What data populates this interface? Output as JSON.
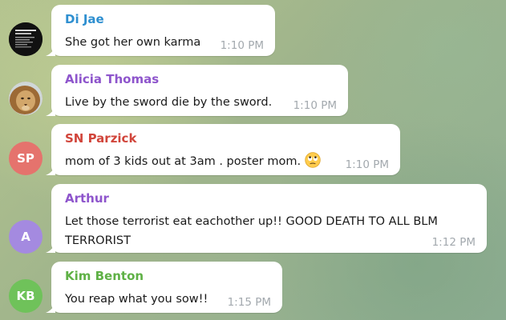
{
  "colors": {
    "bubble": "#ffffff",
    "time": "#a3a9ae",
    "text": "#1a1a1a"
  },
  "messages": [
    {
      "sender": "Di Jae",
      "sender_color": "#2e8fd0",
      "text": "She got her own karma",
      "time": "1:10 PM",
      "avatar": {
        "type": "image",
        "icon": "dark-poster-avatar"
      }
    },
    {
      "sender": "Alicia Thomas",
      "sender_color": "#8e55cc",
      "text": "Live by the sword die by the sword.",
      "time": "1:10 PM",
      "avatar": {
        "type": "image",
        "icon": "lion-photo-avatar"
      }
    },
    {
      "sender": "SN Parzick",
      "sender_color": "#d1453b",
      "text": "mom of 3 kids out at 3am . poster mom.",
      "emoji": "rolling-eyes-emoji",
      "time": "1:10 PM",
      "avatar": {
        "type": "initials",
        "initials": "SP",
        "color": "#e5736d"
      }
    },
    {
      "sender": "Arthur",
      "sender_color": "#8e55cc",
      "text_lines": [
        "Let those terrorist eat eachother up!! GOOD DEATH TO ALL BLM",
        "TERRORIST"
      ],
      "time": "1:12 PM",
      "avatar": {
        "type": "initials",
        "initials": "A",
        "color": "#a48ae0"
      }
    },
    {
      "sender": "Kim Benton",
      "sender_color": "#5fb146",
      "text": "You reap what you sow!!",
      "time": "1:15 PM",
      "avatar": {
        "type": "initials",
        "initials": "KB",
        "color": "#6fc25a"
      }
    }
  ]
}
